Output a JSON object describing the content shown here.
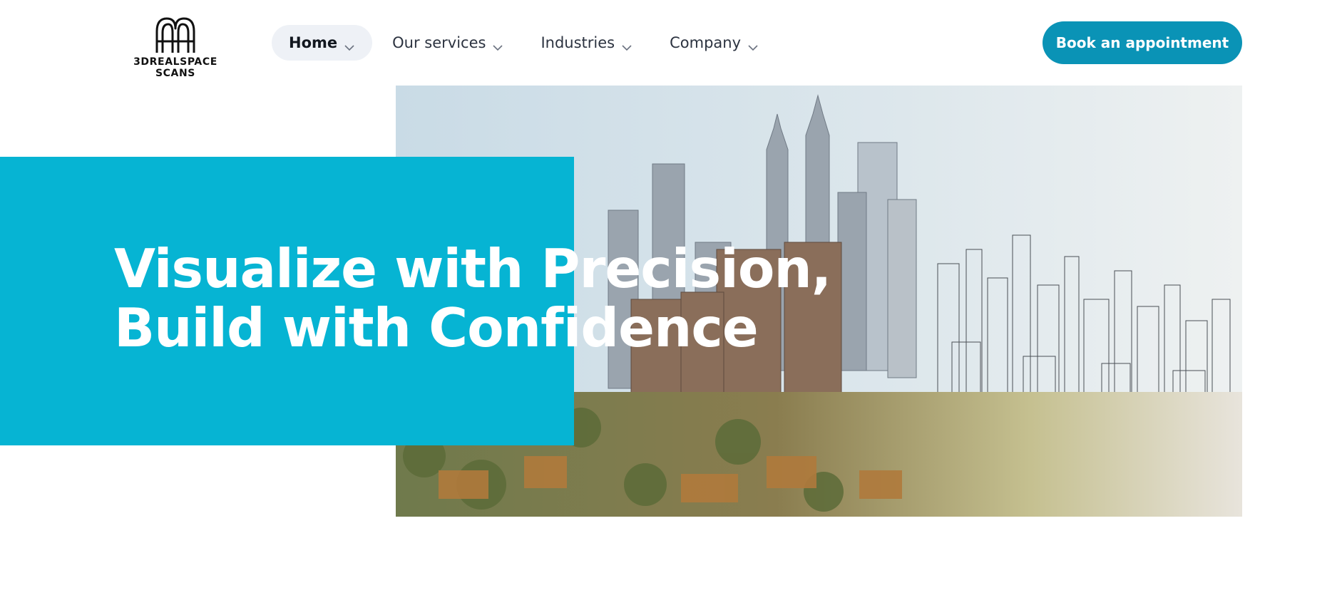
{
  "brand": {
    "logo_icon": "arch-logo-icon",
    "name": "3DREALSPACE SCANS"
  },
  "nav": {
    "items": [
      {
        "label": "Home",
        "icon": "chevron-down-icon",
        "active": true
      },
      {
        "label": "Our services",
        "icon": "chevron-down-icon",
        "active": false
      },
      {
        "label": "Industries",
        "icon": "chevron-down-icon",
        "active": false
      },
      {
        "label": "Company",
        "icon": "chevron-down-icon",
        "active": false
      }
    ]
  },
  "cta": {
    "label": "Book an appointment"
  },
  "hero": {
    "title_line1": "Visualize with Precision,",
    "title_line2": "Build with Confidence",
    "image": "city-skyline-photo-blending-into-sketch"
  },
  "colors": {
    "primary": "#0a93b6",
    "hero_panel": "#06b4d3",
    "nav_active_bg": "#eef1f6",
    "text_dark": "#1b2330",
    "background": "#ffffff"
  }
}
